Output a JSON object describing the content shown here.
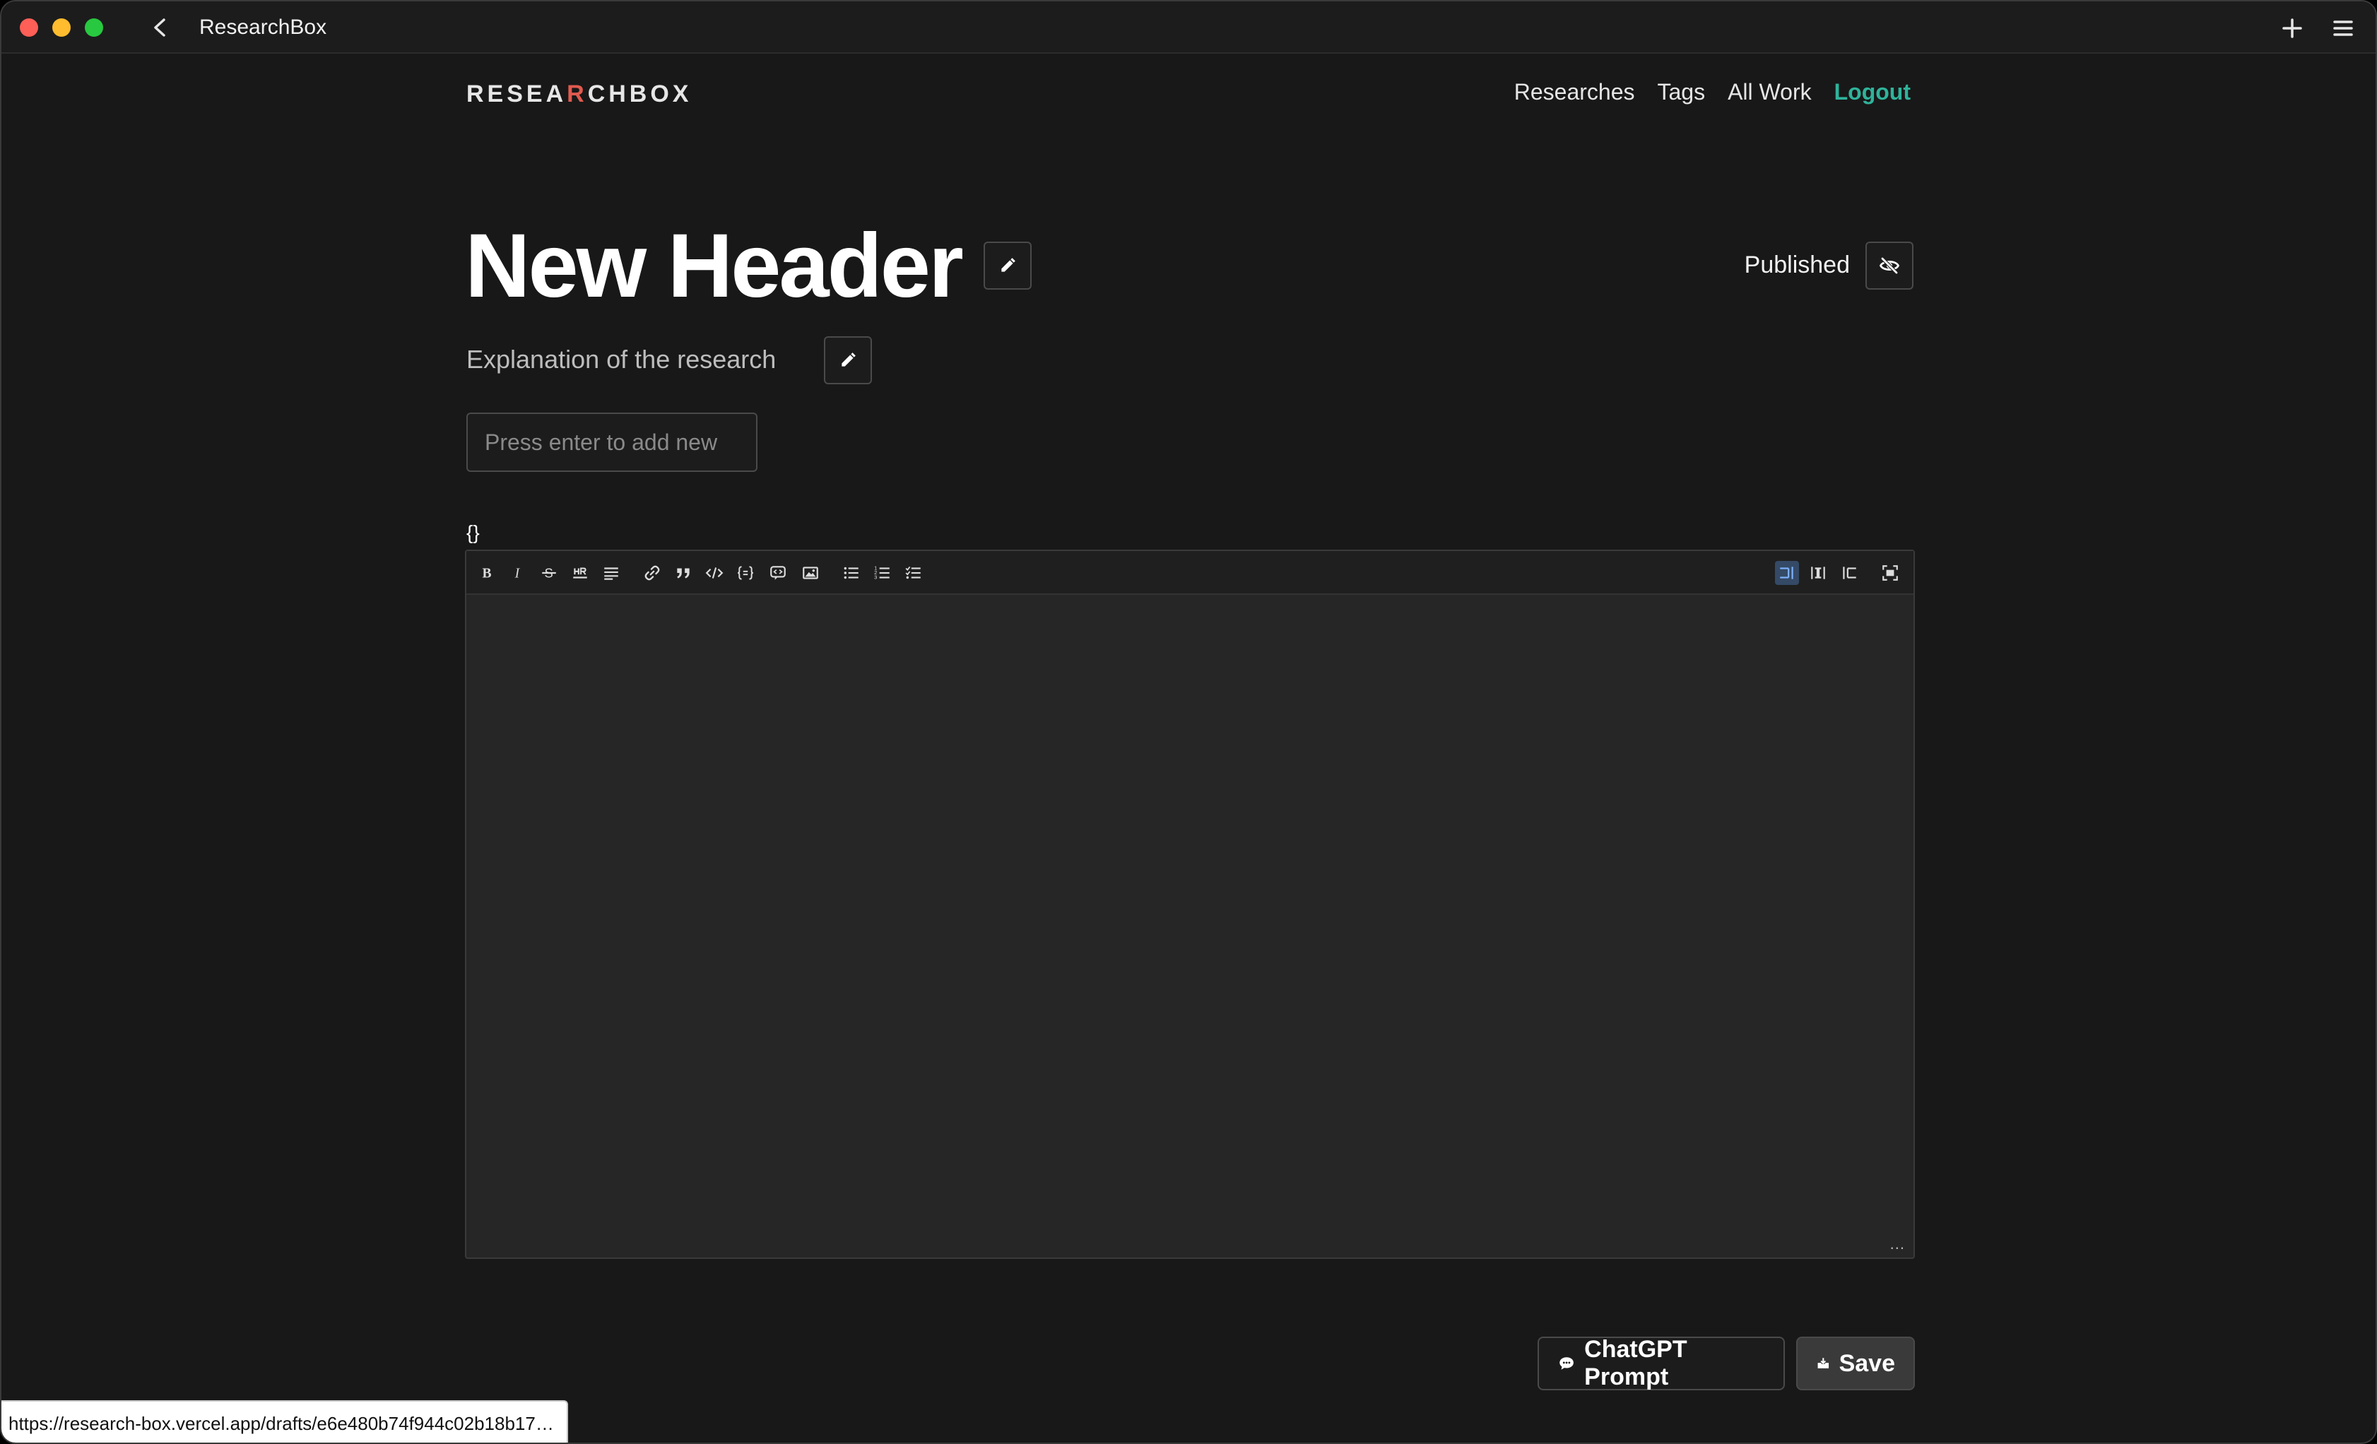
{
  "window": {
    "title": "ResearchBox"
  },
  "nav": {
    "logo_pre": "RESEA",
    "logo_accent": "R",
    "logo_post": "CHBOX",
    "items": [
      "Researches",
      "Tags",
      "All Work"
    ],
    "logout": "Logout"
  },
  "research": {
    "title": "New Header",
    "published_label": "Published",
    "description": "Explanation of the research"
  },
  "tags": {
    "placeholder": "Press enter to add new"
  },
  "editor": {
    "raw_value": "{}",
    "resize_hint": "..."
  },
  "actions": {
    "chatgpt": "ChatGPT Prompt",
    "save": "Save"
  },
  "status_url": "https://research-box.vercel.app/drafts/e6e480b74f944c02b18b17…"
}
